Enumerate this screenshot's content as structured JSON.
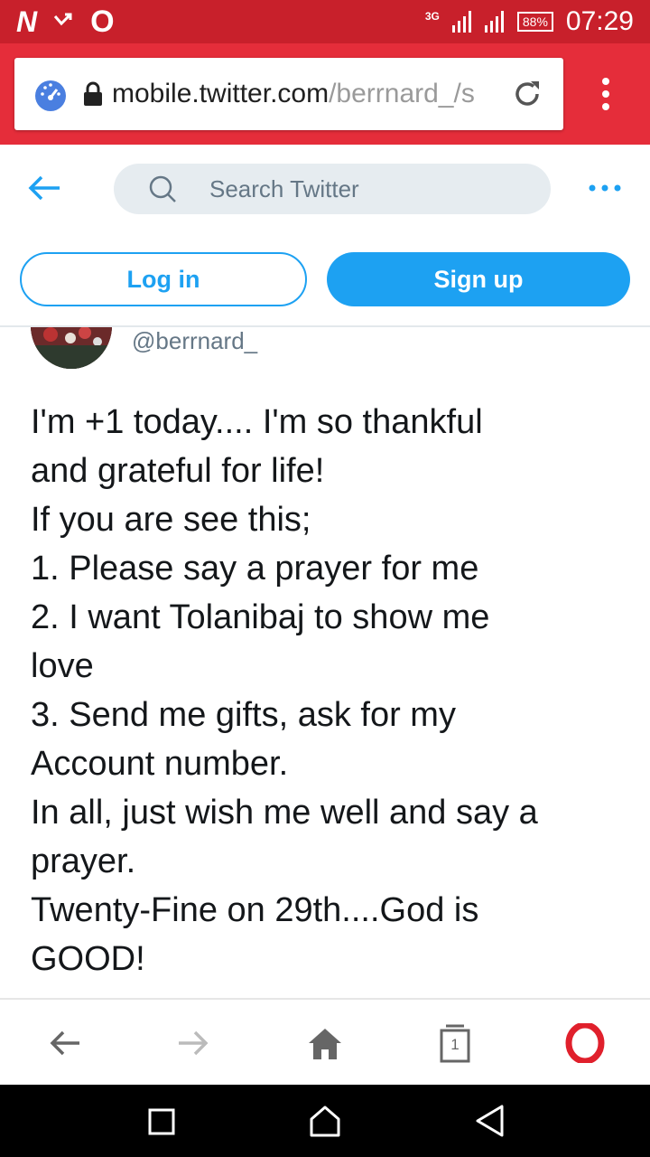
{
  "status_bar": {
    "left_icons": [
      "n-notification-icon",
      "missed-call-icon",
      "opera-icon"
    ],
    "network": "3G",
    "battery": "88%",
    "time": "07:29"
  },
  "browser": {
    "url_host": "mobile.twitter.com",
    "url_path": "/berrnard_/s",
    "icons": [
      "speed-dial-icon",
      "lock-icon",
      "reload-icon",
      "menu-dots-icon"
    ]
  },
  "twitter_header": {
    "search_placeholder": "Search Twitter",
    "login_label": "Log in",
    "signup_label": "Sign up",
    "accent_color": "#1da1f2"
  },
  "tweet": {
    "handle": "@berrnard_",
    "lines": [
      "I'm +1 today.... I'm so thankful",
      "and grateful for life!",
      "If you are see this;",
      "1. Please say a prayer for me",
      "2. I want Tolanibaj to show me",
      "love",
      "3. Send me gifts, ask for my",
      "Account number.",
      "In all, just wish me well and say a",
      "prayer.",
      "Twenty-Fine on 29th....God is",
      "GOOD!"
    ]
  },
  "bottom_nav": {
    "tab_count": "1",
    "icons": [
      "back-icon",
      "forward-icon",
      "home-icon",
      "tabs-icon",
      "opera-menu-icon"
    ]
  },
  "system_nav": {
    "icons": [
      "recent-apps-icon",
      "home-icon",
      "back-icon"
    ]
  }
}
